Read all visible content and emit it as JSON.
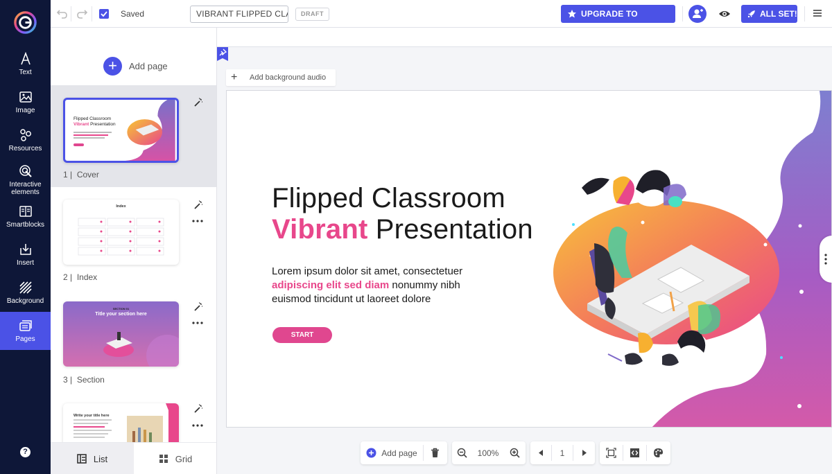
{
  "sidebar": {
    "items": [
      {
        "label": "Text",
        "icon": "text-icon"
      },
      {
        "label": "Image",
        "icon": "image-icon"
      },
      {
        "label": "Resources",
        "icon": "resources-icon"
      },
      {
        "label": "Interactive elements",
        "icon": "interactive-icon"
      },
      {
        "label": "Smartblocks",
        "icon": "smartblocks-icon"
      },
      {
        "label": "Insert",
        "icon": "insert-icon"
      },
      {
        "label": "Background",
        "icon": "background-icon"
      },
      {
        "label": "Pages",
        "icon": "pages-icon",
        "active": true
      }
    ],
    "help": "?"
  },
  "toolbar": {
    "saved_label": "Saved",
    "title_value": "VIBRANT FLIPPED CLASSROOM",
    "draft_label": "DRAFT",
    "upgrade_label": "UPGRADE TO PREMIUM",
    "allset_label": "ALL SET!"
  },
  "panel": {
    "add_page_label": "Add page",
    "pages": [
      {
        "number": "1",
        "name": "Cover",
        "selected": true,
        "thumb_title": "Flipped Classroom",
        "thumb_title_pink": "Vibrant",
        "thumb_title_rest": "Presentation"
      },
      {
        "number": "2",
        "name": "Index",
        "thumb_title": "Index"
      },
      {
        "number": "3",
        "name": "Section",
        "thumb_kicker": "SECTION 01",
        "thumb_title": "Title your section here"
      },
      {
        "number": "4",
        "name": "",
        "thumb_title": "Write your title here"
      }
    ],
    "tabs": {
      "list": "List",
      "grid": "Grid"
    }
  },
  "canvas": {
    "bg_audio_label": "Add background audio",
    "slide": {
      "title_line1": "Flipped Classroom",
      "title_pink": "Vibrant",
      "title_rest": " Presentation",
      "body_line1": "Lorem ipsum dolor sit amet, consectetuer",
      "body_pink": "adipiscing elit sed diam",
      "body_rest1": " nonummy nibh",
      "body_line3": "euismod tincidunt ut laoreet dolore",
      "button_label": "START"
    }
  },
  "bottom_bar": {
    "add_page_label": "Add page",
    "zoom_value": "100%",
    "page_number": "1"
  },
  "colors": {
    "accent": "#4b52e6",
    "rail_bg": "#0e1738",
    "pink": "#e8478b"
  }
}
